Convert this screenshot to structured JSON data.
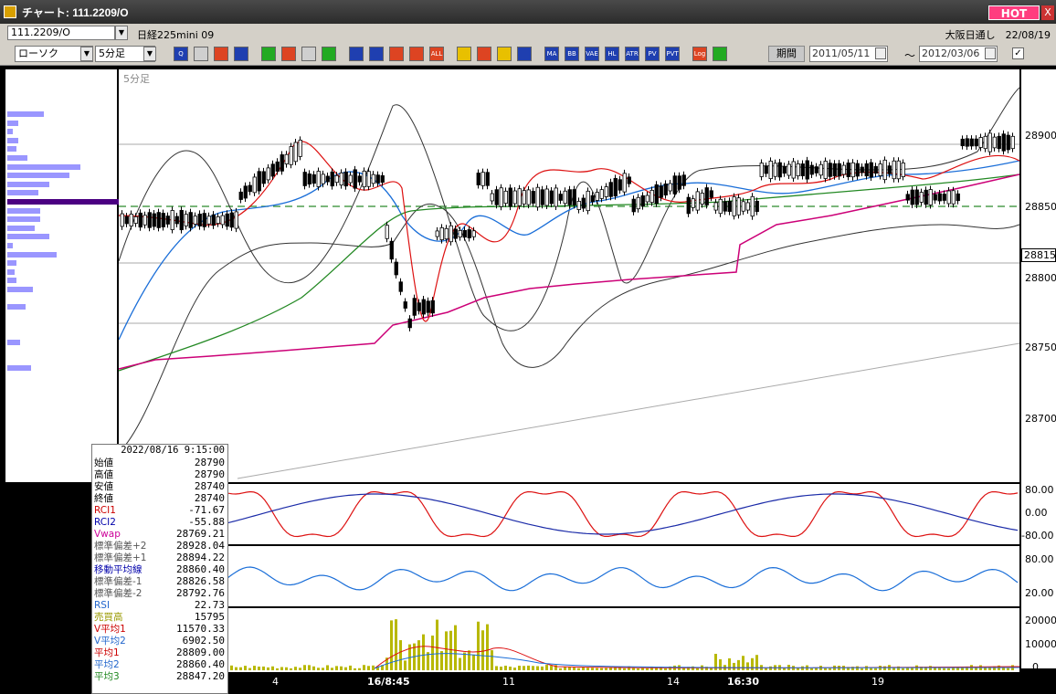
{
  "window": {
    "title": "チャート: 111.2209/O",
    "hot_label": "HOT",
    "close_label": "X"
  },
  "symbol_bar": {
    "symbol": "111.2209/O",
    "instrument": "日経225mini 09",
    "session_date": "大阪日通し　22/08/19"
  },
  "toolbar": {
    "chart_type": "ローソク",
    "interval": "5分足",
    "buttons": [
      "Q",
      "",
      "",
      "",
      "",
      "",
      "",
      "",
      "",
      "",
      "",
      "",
      "ALL",
      "",
      "",
      "",
      "",
      "MA",
      "BB",
      "VAE",
      "HL",
      "ATR",
      "PV",
      "PVT",
      "Log",
      ""
    ],
    "period_label": "期間",
    "date_from": "2011/05/11",
    "date_to": "2012/03/06",
    "date_separator": "〜",
    "check": "✓"
  },
  "chart": {
    "interval_label": "5分足",
    "current_price": "28815",
    "y_labels": [
      "28900",
      "28850",
      "28800",
      "28750",
      "28700"
    ],
    "osc_labels": [
      "80.00",
      "0.00",
      "-80.00"
    ],
    "rsi_labels": [
      "80.00",
      "20.00"
    ],
    "vol_labels": [
      "20000",
      "10000",
      "0"
    ],
    "x_labels": [
      {
        "t": "4",
        "b": false
      },
      {
        "t": "16/8:45",
        "b": true
      },
      {
        "t": "11",
        "b": false
      },
      {
        "t": "14",
        "b": false
      },
      {
        "t": "16:30",
        "b": true
      },
      {
        "t": "19",
        "b": false
      }
    ]
  },
  "info": {
    "datetime": "2022/08/16  9:15:00",
    "rows": [
      {
        "k": "始値",
        "v": "28790",
        "c": "#000000"
      },
      {
        "k": "高値",
        "v": "28790",
        "c": "#000000"
      },
      {
        "k": "安値",
        "v": "28740",
        "c": "#000000"
      },
      {
        "k": "終値",
        "v": "28740",
        "c": "#000000"
      },
      {
        "k": "RCI1",
        "v": "-71.67",
        "c": "#cc0000"
      },
      {
        "k": "RCI2",
        "v": "-55.88",
        "c": "#0000aa"
      },
      {
        "k": "Vwap",
        "v": "28769.21",
        "c": "#cc0099"
      },
      {
        "k": "標準偏差+2",
        "v": "28928.04",
        "c": "#555555"
      },
      {
        "k": "標準偏差+1",
        "v": "28894.22",
        "c": "#555555"
      },
      {
        "k": "移動平均線",
        "v": "28860.40",
        "c": "#0000aa"
      },
      {
        "k": "標準偏差-1",
        "v": "28826.58",
        "c": "#555555"
      },
      {
        "k": "標準偏差-2",
        "v": "28792.76",
        "c": "#555555"
      },
      {
        "k": "RSI",
        "v": "22.73",
        "c": "#2266cc"
      },
      {
        "k": "売買高",
        "v": "15795",
        "c": "#999900"
      },
      {
        "k": "V平均1",
        "v": "11570.33",
        "c": "#cc0000"
      },
      {
        "k": "V平均2",
        "v": "6902.50",
        "c": "#2266cc"
      },
      {
        "k": "平均1",
        "v": "28809.00",
        "c": "#cc0000"
      },
      {
        "k": "平均2",
        "v": "28860.40",
        "c": "#2266cc"
      },
      {
        "k": "平均3",
        "v": "28847.20",
        "c": "#228822"
      }
    ]
  }
}
